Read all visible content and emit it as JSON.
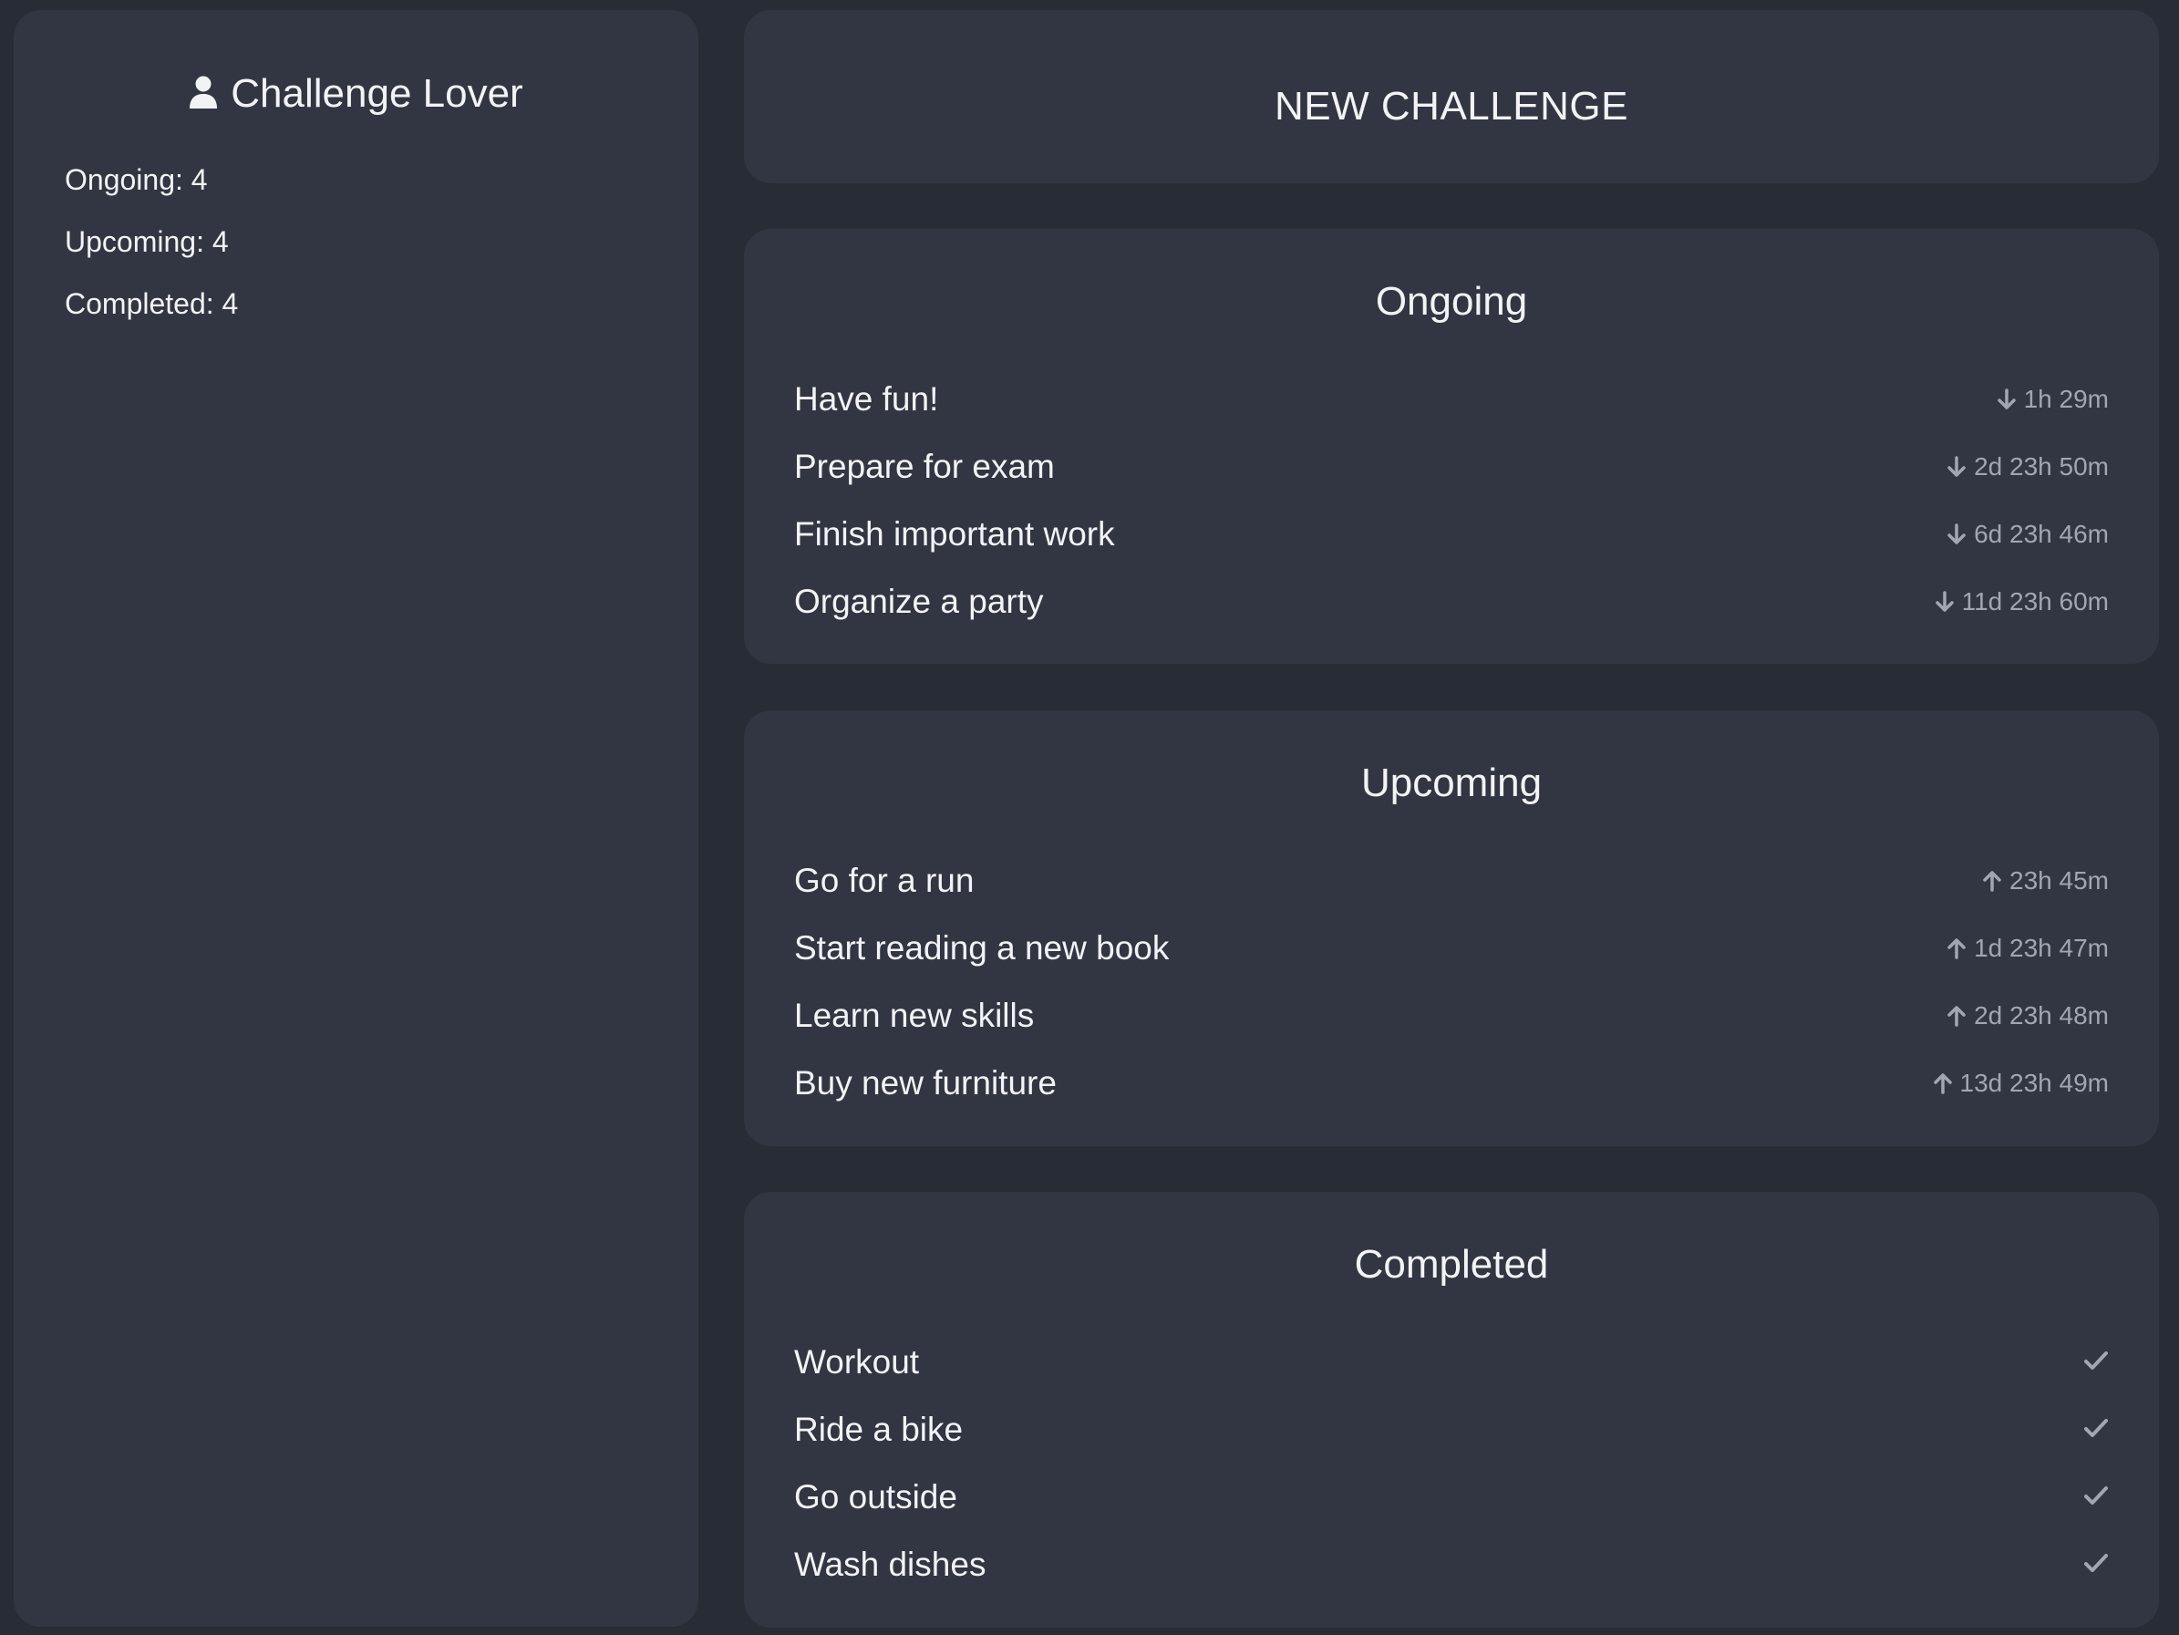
{
  "profile": {
    "icon": "user-icon",
    "name": "Challenge Lover",
    "stats": [
      {
        "label": "Ongoing: 4"
      },
      {
        "label": "Upcoming: 4"
      },
      {
        "label": "Completed: 4"
      }
    ]
  },
  "new_challenge": {
    "label": "NEW CHALLENGE"
  },
  "ongoing": {
    "title": "Ongoing",
    "icon": "arrow-down-icon",
    "items": [
      {
        "name": "Have fun!",
        "time": "1h 29m"
      },
      {
        "name": "Prepare for exam",
        "time": "2d 23h 50m"
      },
      {
        "name": "Finish important work",
        "time": "6d 23h 46m"
      },
      {
        "name": "Organize a party",
        "time": "11d 23h 60m"
      }
    ]
  },
  "upcoming": {
    "title": "Upcoming",
    "icon": "arrow-up-icon",
    "items": [
      {
        "name": "Go for a run",
        "time": "23h 45m"
      },
      {
        "name": "Start reading a new book",
        "time": "1d 23h 47m"
      },
      {
        "name": "Learn new skills",
        "time": "2d 23h 48m"
      },
      {
        "name": "Buy new furniture",
        "time": "13d 23h 49m"
      }
    ]
  },
  "completed": {
    "title": "Completed",
    "icon": "check-icon",
    "items": [
      {
        "name": "Workout"
      },
      {
        "name": "Ride a bike"
      },
      {
        "name": "Go outside"
      },
      {
        "name": "Wash dishes"
      }
    ]
  },
  "colors": {
    "background": "#282c36",
    "panel": "#323643",
    "text": "#f2f3f5",
    "muted": "#a2a6b0"
  }
}
